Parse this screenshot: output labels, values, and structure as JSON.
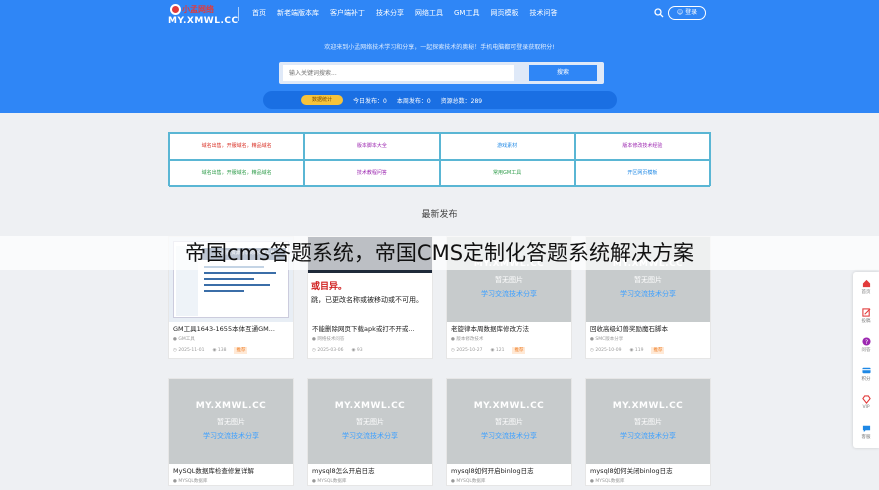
{
  "header": {
    "logo_top": "小孟网络",
    "logo_main": "MY.XMWL.CC",
    "nav": [
      "首页",
      "新老端版本库",
      "客户端补丁",
      "技术分享",
      "网络工具",
      "GM工具",
      "网页模板",
      "技术问答"
    ],
    "login_label": "登录",
    "welcome": "欢迎来到小孟网络技术学习和分享，一起探索技术的奥秘！手机电脑都可登录获取积分!",
    "search_placeholder": "输入关键词搜索...",
    "search_button": "搜索",
    "stats_badge": "数据统计",
    "stats": [
      "今日发布：0",
      "本周发布：0",
      "资源总数：289"
    ]
  },
  "links": [
    {
      "label": "域名出售，开服域名，精品域名",
      "color": "#d93025"
    },
    {
      "label": "版本脚本大全",
      "color": "#9c27b0"
    },
    {
      "label": "游戏素材",
      "color": "#1e88e5"
    },
    {
      "label": "版本修改技术经验",
      "color": "#9c27b0"
    },
    {
      "label": "域名出售，开服域名，精品域名",
      "color": "#2e9c4a"
    },
    {
      "label": "技术教程问答",
      "color": "#9c27b0"
    },
    {
      "label": "常用GM工具",
      "color": "#2e9c4a"
    },
    {
      "label": "开区网页模板",
      "color": "#1e88e5"
    }
  ],
  "section_title": "最新发布",
  "placeholder": {
    "line1": "MY.XMWL.CC",
    "line2": "暂无图片",
    "line3": "学习交流技术分享"
  },
  "thumb_texts": {
    "shot1_top": "小孟网络资源分享网站GM工具",
    "shot2_red": "或目异。",
    "shot2_black": "跳，已更改名称或被移动或不可用。"
  },
  "cards": [
    {
      "title": "GM工具1643-1655本体互通GM...",
      "category": "GM工具",
      "date": "2025-11-01",
      "views": "138",
      "tag": "推荐"
    },
    {
      "title": "不能删除网页下载apk或打不开或...",
      "category": "网络技术问答",
      "date": "2025-03-06",
      "views": "93",
      "tag": ""
    },
    {
      "title": "老旋律本周数据库修改方法",
      "category": "版本修改技术",
      "date": "2025-10-27",
      "views": "121",
      "tag": "推荐"
    },
    {
      "title": "回收高级幻兽奖励魔石脚本",
      "category": "SMC版本分享",
      "date": "2025-10-09",
      "views": "119",
      "tag": "推荐"
    },
    {
      "title": "MySQL数据库检查修复详解",
      "category": "MYSQL数据库",
      "date": "",
      "views": "",
      "tag": ""
    },
    {
      "title": "mysql8怎么开启日志",
      "category": "MYSQL数据库",
      "date": "",
      "views": "",
      "tag": ""
    },
    {
      "title": "mysql8如何开启binlog日志",
      "category": "MYSQL数据库",
      "date": "",
      "views": "",
      "tag": ""
    },
    {
      "title": "mysql8如何关闭binlog日志",
      "category": "MYSQL数据库",
      "date": "",
      "views": "",
      "tag": ""
    }
  ],
  "overlay_caption": "帝国cms答题系统，帝国CMS定制化答题系统解决方案",
  "sidebar": [
    {
      "label": "首页",
      "icon": "home-icon",
      "color": "#e23b3b"
    },
    {
      "label": "投稿",
      "icon": "edit-icon",
      "color": "#e23b3b"
    },
    {
      "label": "问答",
      "icon": "question-icon",
      "color": "#9c27b0"
    },
    {
      "label": "积分",
      "icon": "card-icon",
      "color": "#1e88e5"
    },
    {
      "label": "VIP",
      "icon": "diamond-icon",
      "color": "#e23b3b"
    },
    {
      "label": "客服",
      "icon": "chat-icon",
      "color": "#1e88e5"
    }
  ]
}
